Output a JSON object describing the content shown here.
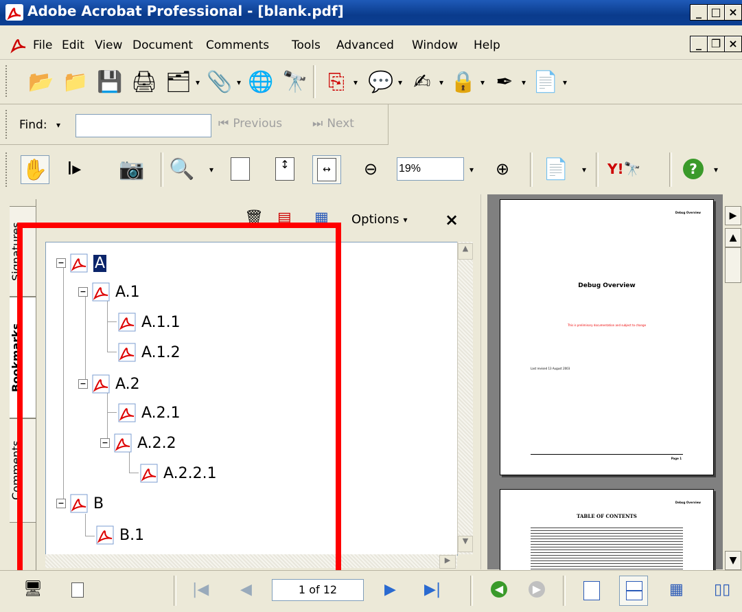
{
  "window": {
    "title": "Adobe Acrobat Professional - [blank.pdf]"
  },
  "menu": {
    "items": [
      "File",
      "Edit",
      "View",
      "Document",
      "Comments",
      "Tools",
      "Advanced",
      "Window",
      "Help"
    ]
  },
  "find": {
    "label": "Find:",
    "value": "",
    "previous": "Previous",
    "next": "Next"
  },
  "zoom": {
    "value": "19%"
  },
  "bookmarks_panel": {
    "options_label": "Options",
    "close_label": "×",
    "tabs": [
      "Signatures",
      "Bookmarks",
      "Comments"
    ],
    "tree": [
      {
        "label": "A"
      },
      {
        "label": "A.1"
      },
      {
        "label": "A.1.1"
      },
      {
        "label": "A.1.2"
      },
      {
        "label": "A.2"
      },
      {
        "label": "A.2.1"
      },
      {
        "label": "A.2.2"
      },
      {
        "label": "A.2.2.1"
      },
      {
        "label": "B"
      },
      {
        "label": "B.1"
      }
    ]
  },
  "document": {
    "page1": {
      "header": "Debug Overview",
      "title": "Debug Overview",
      "subtitle": "This is preliminary documentation and subject to change",
      "date": "Last revised 13 August 2003",
      "footer": "Page 1"
    },
    "page2": {
      "header": "Debug Overview",
      "title": "TABLE OF CONTENTS"
    }
  },
  "navigation": {
    "page_indicator": "1 of 12"
  },
  "colors": {
    "highlight_box": "#ff0000",
    "titlebar": "#0a3b8c"
  }
}
